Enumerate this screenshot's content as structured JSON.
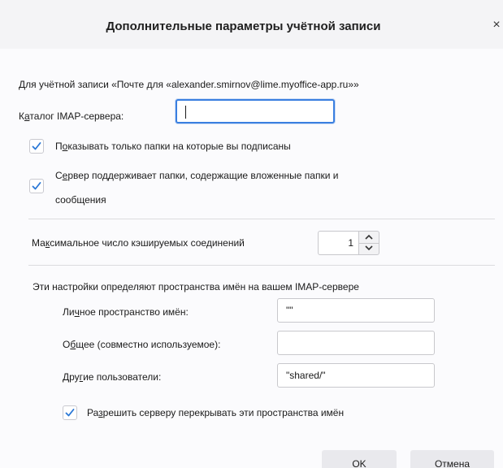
{
  "dialog": {
    "title": "Дополнительные параметры учётной записи",
    "close_glyph": "×"
  },
  "account_info": "Для учётной записи «Почте для «alexander.smirnov@lime.myoffice-app.ru»»",
  "imap_dir": {
    "label_before": "К",
    "label_accel": "а",
    "label_after": "талог IMAP-сервера:",
    "value": ""
  },
  "subscribed_only": {
    "label_before": "П",
    "label_accel": "о",
    "label_after": "казывать только папки на которые вы подписаны",
    "checked": true
  },
  "server_folders": {
    "label_line1_before": "С",
    "label_line1_accel": "е",
    "label_line1_after": "рвер поддерживает папки, содержащие вложенные папки и",
    "label_line2": "сообщения",
    "checked": true
  },
  "max_connections": {
    "label_before": "Ма",
    "label_accel": "к",
    "label_after": "симальное число кэшируемых соединений",
    "value": "1"
  },
  "namespaces": {
    "intro": "Эти настройки определяют пространства имён на вашем IMAP-сервере",
    "personal": {
      "label_before": "Ли",
      "label_accel": "ч",
      "label_after": "ное пространство имён:",
      "value": "\"\""
    },
    "public": {
      "label_before": "О",
      "label_accel": "б",
      "label_after": "щее (совместно используемое):",
      "value": ""
    },
    "other_users": {
      "label_before": "Дру",
      "label_accel": "г",
      "label_after": "ие пользователи:",
      "value": "\"shared/\""
    },
    "allow_override": {
      "label_before": "Ра",
      "label_accel": "з",
      "label_after": "решить серверу перекрывать эти пространства имён",
      "checked": true
    }
  },
  "buttons": {
    "ok": "OK",
    "cancel": "Отмена"
  },
  "colors": {
    "accent": "#3a7fe0",
    "checkmark": "#2a78d6"
  }
}
